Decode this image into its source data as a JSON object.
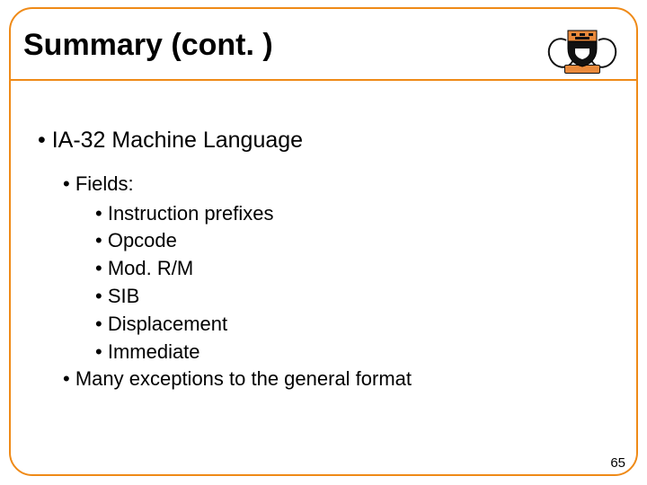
{
  "title": "Summary (cont. )",
  "logo_name": "princeton-shield-crest",
  "bullets": {
    "level1": "IA-32 Machine Language",
    "fields_label": "Fields:",
    "fields": [
      "Instruction prefixes",
      "Opcode",
      "Mod. R/M",
      "SIB",
      "Displacement",
      "Immediate"
    ],
    "exceptions": "Many exceptions to the general format"
  },
  "page_number": "65",
  "colors": {
    "accent": "#ef8a17",
    "shield_top": "#e9893b",
    "shield_body": "#111111"
  }
}
